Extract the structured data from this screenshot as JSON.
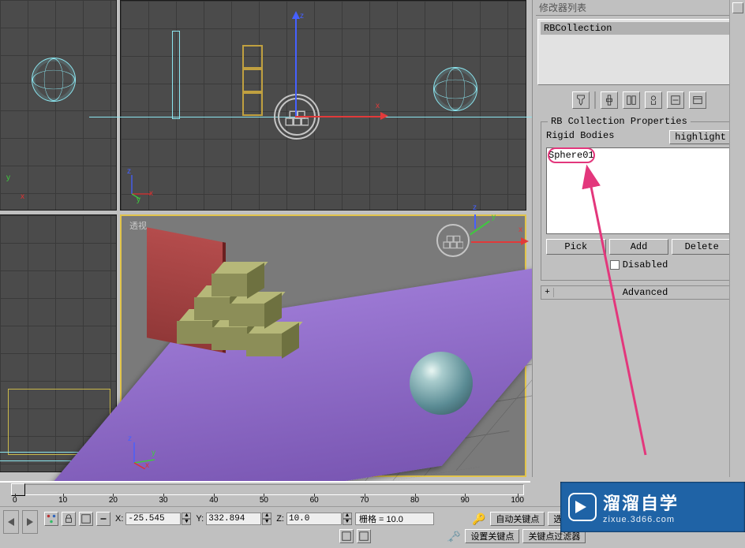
{
  "modifier_panel_title": "修改器列表",
  "modifier_stack_item": "RBCollection",
  "icon_names": [
    "pin",
    "pipe",
    "play-pause",
    "lightbulb",
    "layers"
  ],
  "rb_props": {
    "group_title": "RB Collection Properties",
    "rigid_bodies_label": "Rigid Bodies",
    "highlight_btn": "highlight",
    "list_items": [
      "Sphere01"
    ],
    "pick_btn": "Pick",
    "add_btn": "Add",
    "delete_btn": "Delete",
    "disabled_label": "Disabled"
  },
  "advanced_label": "Advanced",
  "viewport": {
    "persp_label": "透视"
  },
  "axis": {
    "x": "x",
    "y": "y",
    "z": "z"
  },
  "timeline": {
    "ticks": [
      "0",
      "10",
      "20",
      "30",
      "40",
      "50",
      "60",
      "70",
      "80",
      "90",
      "100"
    ]
  },
  "status": {
    "x_label": "X:",
    "y_label": "Y:",
    "z_label": "Z:",
    "x_val": "-25.545",
    "y_val": "332.894",
    "z_val": "10.0",
    "grid_label": "栅格 = 10.0",
    "auto_key": "自动关键点",
    "selected": "选定对象",
    "set_key_left": "设置关键点",
    "set_key_right": "关键点过滤器"
  },
  "watermark": {
    "brand": "溜溜自学",
    "url": "zixue.3d66.com"
  }
}
